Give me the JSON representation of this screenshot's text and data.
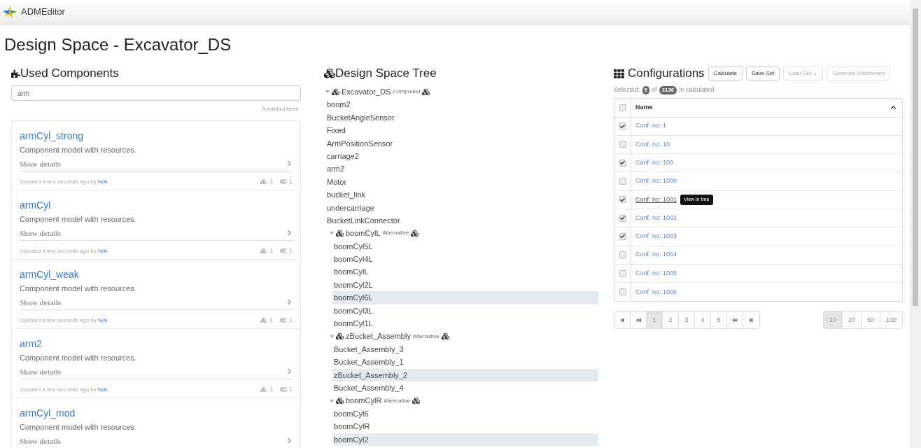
{
  "app_bar": {
    "title": "ADMEditor"
  },
  "page_title": "Design Space - Excavator_DS",
  "used_components": {
    "heading": "Used Components",
    "search": {
      "value": "arm"
    },
    "match_count": "5 matched items",
    "cards": [
      {
        "name": "armCyl_strong",
        "description": "Component model with resources.",
        "details_link": "Show details",
        "updated": "Updated a few seconds ago by",
        "author": "N/A",
        "count_1": "1",
        "count_2": "1"
      },
      {
        "name": "armCyl",
        "description": "Component model with resources.",
        "details_link": "Show details",
        "updated": "Updated a few seconds ago by",
        "author": "N/A",
        "count_1": "1",
        "count_2": "1"
      },
      {
        "name": "armCyl_weak",
        "description": "Component model with resources.",
        "details_link": "Show details",
        "updated": "Updated a few seconds ago by",
        "author": "N/A",
        "count_1": "1",
        "count_2": "1"
      },
      {
        "name": "arm2",
        "description": "Component model with resources.",
        "details_link": "Show details",
        "updated": "Updated a few seconds ago by",
        "author": "N/A",
        "count_1": "1",
        "count_2": "1"
      },
      {
        "name": "armCyl_mod",
        "description": "Component model with resources.",
        "details_link": "Show details"
      }
    ]
  },
  "tree": {
    "heading": "Design Space Tree",
    "root": {
      "name": "Excavator_DS",
      "type": "Compound",
      "expanded": true,
      "children": [
        {
          "kind": "leaf",
          "name": "boom2",
          "selected": false
        },
        {
          "kind": "leaf",
          "name": "BucketAngleSensor",
          "selected": false
        },
        {
          "kind": "leaf",
          "name": "Fixed",
          "selected": false
        },
        {
          "kind": "leaf",
          "name": "ArmPositionSensor",
          "selected": false
        },
        {
          "kind": "leaf",
          "name": "carriage2",
          "selected": false
        },
        {
          "kind": "leaf",
          "name": "arm2",
          "selected": false
        },
        {
          "kind": "leaf",
          "name": "Motor",
          "selected": false
        },
        {
          "kind": "leaf",
          "name": "bucket_link",
          "selected": false
        },
        {
          "kind": "leaf",
          "name": "undercarriage",
          "selected": false
        },
        {
          "kind": "leaf",
          "name": "BucketLinkConnector",
          "selected": false
        },
        {
          "kind": "container",
          "name": "boomCylL",
          "type": "Alternative",
          "expanded": true,
          "children": [
            {
              "kind": "leaf",
              "name": "boomCyl5L",
              "selected": false
            },
            {
              "kind": "leaf",
              "name": "boomCyl4L",
              "selected": false
            },
            {
              "kind": "leaf",
              "name": "boomCylL",
              "selected": false
            },
            {
              "kind": "leaf",
              "name": "boomCyl2L",
              "selected": false
            },
            {
              "kind": "leaf",
              "name": "boomCyl6L",
              "selected": true
            },
            {
              "kind": "leaf",
              "name": "boomCyl3L",
              "selected": false
            },
            {
              "kind": "leaf",
              "name": "boomCyl1L",
              "selected": false
            }
          ]
        },
        {
          "kind": "container",
          "name": "zBucket_Assembly",
          "type": "Alternative",
          "expanded": true,
          "children": [
            {
              "kind": "leaf",
              "name": "Bucket_Assembly_3",
              "selected": false
            },
            {
              "kind": "leaf",
              "name": "Bucket_Assembly_1",
              "selected": false
            },
            {
              "kind": "leaf",
              "name": "zBucket_Assembly_2",
              "selected": true
            },
            {
              "kind": "leaf",
              "name": "Bucket_Assembly_4",
              "selected": false
            }
          ]
        },
        {
          "kind": "container",
          "name": "boomCylR",
          "type": "Alternative",
          "expanded": true,
          "children": [
            {
              "kind": "leaf",
              "name": "boomCyl6",
              "selected": false
            },
            {
              "kind": "leaf",
              "name": "boomCylR",
              "selected": false
            },
            {
              "kind": "leaf",
              "name": "boomCyl2",
              "selected": true
            }
          ]
        }
      ]
    }
  },
  "configurations": {
    "heading": "Configurations",
    "buttons": [
      {
        "label": "Calculate",
        "disabled": false,
        "dropdown": false
      },
      {
        "label": "Save Set",
        "disabled": false,
        "dropdown": false
      },
      {
        "label": "Load Set",
        "disabled": true,
        "dropdown": true
      },
      {
        "label": "Generate Dashboard",
        "disabled": true,
        "dropdown": false
      }
    ],
    "summary": {
      "prefix": "Selected:",
      "selected_count": "5",
      "middle": "of",
      "total": "3136",
      "suffix": "in calculated"
    },
    "table": {
      "select_all_checked": false,
      "column": "Name",
      "tooltip": "View in tree",
      "rows": [
        {
          "name": "Conf. no: 1",
          "checked": true,
          "hovered": false
        },
        {
          "name": "Conf. no: 10",
          "checked": false,
          "hovered": false
        },
        {
          "name": "Conf. no: 100",
          "checked": true,
          "hovered": false
        },
        {
          "name": "Conf. no: 1000",
          "checked": false,
          "hovered": false
        },
        {
          "name": "Conf. no: 1001",
          "checked": true,
          "hovered": true
        },
        {
          "name": "Conf. no: 1002",
          "checked": true,
          "hovered": false
        },
        {
          "name": "Conf. no: 1003",
          "checked": true,
          "hovered": false
        },
        {
          "name": "Conf. no: 1004",
          "checked": false,
          "hovered": false
        },
        {
          "name": "Conf. no: 1005",
          "checked": false,
          "hovered": false
        },
        {
          "name": "Conf. no: 1006",
          "checked": false,
          "hovered": false
        }
      ]
    },
    "pager": [
      {
        "kind": "first"
      },
      {
        "kind": "prev"
      },
      {
        "kind": "page",
        "label": "1",
        "selected": true
      },
      {
        "kind": "page",
        "label": "2",
        "selected": false
      },
      {
        "kind": "page",
        "label": "3",
        "selected": false
      },
      {
        "kind": "page",
        "label": "4",
        "selected": false
      },
      {
        "kind": "page",
        "label": "5",
        "selected": false
      },
      {
        "kind": "next"
      },
      {
        "kind": "last"
      }
    ],
    "page_sizes": [
      {
        "label": "10",
        "selected": true
      },
      {
        "label": "20",
        "selected": false
      },
      {
        "label": "50",
        "selected": false
      },
      {
        "label": "100",
        "selected": false
      }
    ]
  }
}
